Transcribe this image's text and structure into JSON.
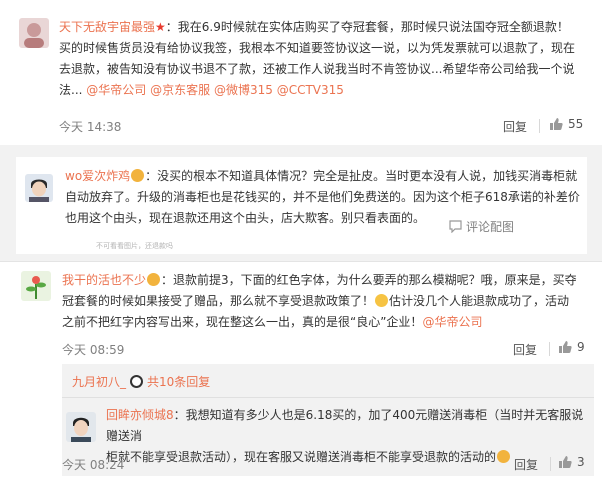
{
  "comments": [
    {
      "user": "天下无敌宇宙最强",
      "text_lines": [
        "：我在6.9时候就在实体店购买了夺冠套餐，那时候只说法国夺冠全额退款！",
        "买的时候售货员没有给协议我签，我根本不知道要签协议这一说，以为凭发票就可以退款了，现在",
        "去退款，被告知没有协议书退不了款，还被工作人说我当时不肯签协议...希望华帝公司给我一个说",
        "法..."
      ],
      "mentions": [
        "@华帝公司",
        "@京东客服",
        "@微博315",
        "@CCTV315"
      ],
      "time": "今天 14:38",
      "reply_label": "回复",
      "likes": "55"
    },
    {
      "user": "wo爱次炸鸡",
      "text_lines": [
        "：没买的根本不知道具体情况？完全是扯皮。当时更本没有人说，加钱买消毒柜就",
        "自动放弃了。升级的消毒柜也是花钱买的，并不是他们免费送的。因为这个柜子618承诺的补差价",
        "也用这个由头，现在退款还用这个由头，店大欺客。别只看表面的。"
      ],
      "comment_action": "评论配图",
      "residue_text": "不可看看图片，还退款吗"
    },
    {
      "user": "我干的活也不少",
      "text_lines": [
        "：退款前提3，下面的红色字体，为什么要弄的那么模糊呢？哦，原来是，买夺",
        "冠套餐的时候如果接受了赠品，那么就不享受退款政策了！",
        "估计没几个人能退款成功了，活动",
        "之前不把红字内容写出来，现在整这么一出，真的是很“良心”企业！",
        "@华帝公司"
      ],
      "time": "今天 08:59",
      "reply_label": "回复",
      "likes": "9"
    }
  ],
  "sub_thread": {
    "preview_user": "九月初八_",
    "preview_text": "共10条回复",
    "reply": {
      "user": "回眸亦倾城8",
      "text_lines": [
        "：我想知道有多少人也是6.18买的，加了400元赠送消毒柜（当时并无客服说赠送消",
        "柜就不能享受退款活动），现在客服又说赠送消毒柜不能享受退款的活动的"
      ],
      "time": "今天 08:24",
      "reply_label": "回复",
      "likes": "3"
    }
  },
  "colors": {
    "username": "#eb7350",
    "link": "#eb7350",
    "meta": "#808080",
    "page_bg": "#f2f2f2"
  },
  "icons": [
    "thumbs-up-icon",
    "comment-icon",
    "vip-star-badge",
    "emoji-laugh-icon",
    "panda-emoji-icon",
    "warm-emoji-icon"
  ]
}
